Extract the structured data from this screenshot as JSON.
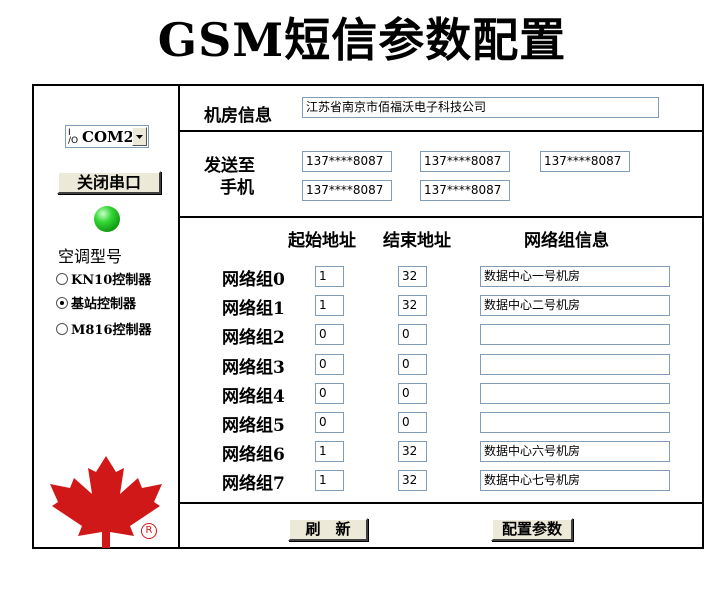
{
  "title": "GSM短信参数配置",
  "com": {
    "prefix": "I/O",
    "value": "COM2"
  },
  "close_port_label": "关闭串口",
  "status_led_color": "#22bb22",
  "aircon_label": "空调型号",
  "aircon_options": [
    {
      "label": "KN10控制器",
      "selected": false
    },
    {
      "label": "基站控制器",
      "selected": true
    },
    {
      "label": "M816控制器",
      "selected": false
    }
  ],
  "logo_color": "#d01818",
  "registered_mark": "R",
  "room_info": {
    "label": "机房信息",
    "value": "江苏省南京市佰福沃电子科技公司"
  },
  "send_to": {
    "label_line1": "发送至",
    "label_line2": "手机",
    "phones": [
      "137****8087",
      "137****8087",
      "137****8087",
      "137****8087",
      "137****8087"
    ]
  },
  "headers": {
    "start": "起始地址",
    "end": "结束地址",
    "info": "网络组信息"
  },
  "groups": [
    {
      "name": "网络组0",
      "start": "1",
      "end": "32",
      "info": "数据中心一号机房"
    },
    {
      "name": "网络组1",
      "start": "1",
      "end": "32",
      "info": "数据中心二号机房"
    },
    {
      "name": "网络组2",
      "start": "0",
      "end": "0",
      "info": ""
    },
    {
      "name": "网络组3",
      "start": "0",
      "end": "0",
      "info": ""
    },
    {
      "name": "网络组4",
      "start": "0",
      "end": "0",
      "info": ""
    },
    {
      "name": "网络组5",
      "start": "0",
      "end": "0",
      "info": ""
    },
    {
      "name": "网络组6",
      "start": "1",
      "end": "32",
      "info": "数据中心六号机房"
    },
    {
      "name": "网络组7",
      "start": "1",
      "end": "32",
      "info": "数据中心七号机房"
    }
  ],
  "refresh_label": "刷　新",
  "configure_label": "配置参数"
}
